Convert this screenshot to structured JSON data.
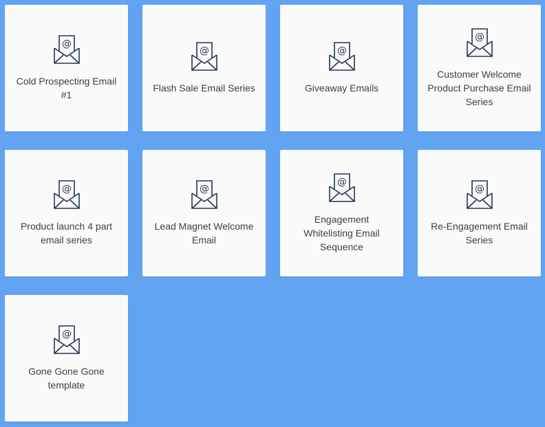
{
  "templates": [
    {
      "title": "Cold Prospecting Email #1",
      "icon": "email-icon"
    },
    {
      "title": "Flash Sale Email Series",
      "icon": "email-icon"
    },
    {
      "title": "Giveaway Emails",
      "icon": "email-icon"
    },
    {
      "title": "Customer Welcome Product Purchase Email Series",
      "icon": "email-icon"
    },
    {
      "title": "Product launch 4 part email series",
      "icon": "email-icon"
    },
    {
      "title": "Lead Magnet Welcome Email",
      "icon": "email-icon"
    },
    {
      "title": "Engagement Whitelisting Email Sequence",
      "icon": "email-icon"
    },
    {
      "title": "Re-Engagement Email Series",
      "icon": "email-icon"
    },
    {
      "title": "Gone Gone Gone template",
      "icon": "email-icon"
    }
  ],
  "colors": {
    "background": "#62a4f2",
    "card": "#fafafa",
    "icon_stroke": "#1f3550",
    "text": "#3a3f46"
  }
}
